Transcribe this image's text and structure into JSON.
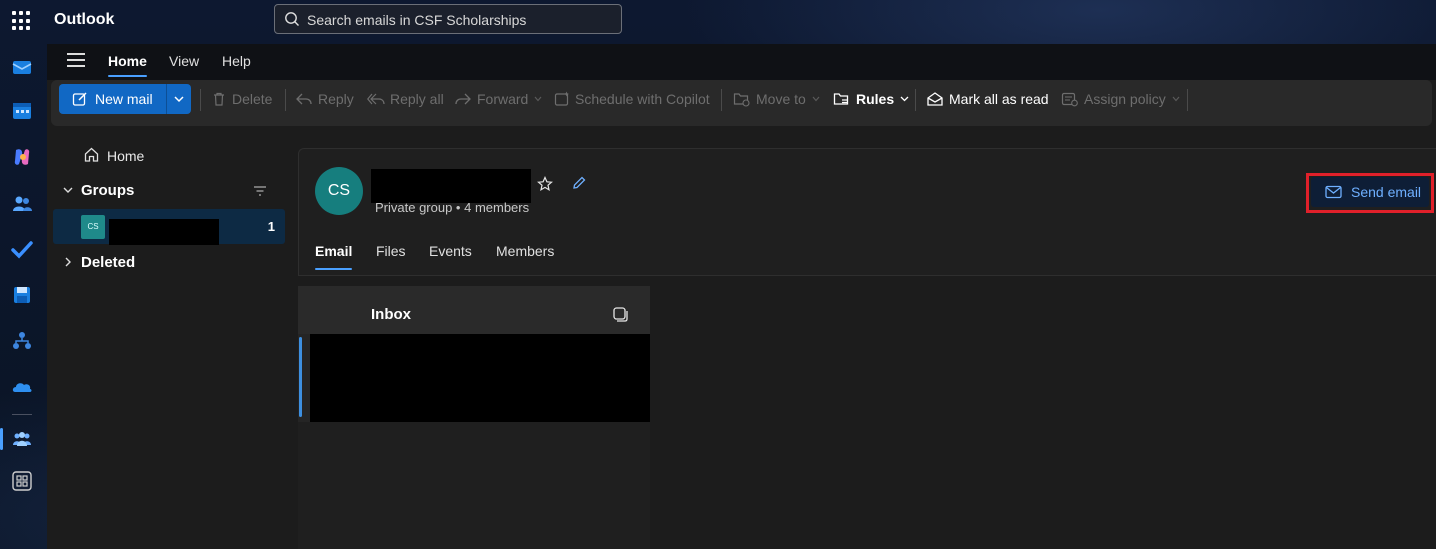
{
  "app": {
    "title": "Outlook"
  },
  "search": {
    "placeholder": "Search emails in CSF Scholarships"
  },
  "menu_tabs": [
    {
      "label": "Home",
      "active": true
    },
    {
      "label": "View",
      "active": false
    },
    {
      "label": "Help",
      "active": false
    }
  ],
  "ribbon": {
    "new_mail": "New mail",
    "delete": "Delete",
    "reply": "Reply",
    "reply_all": "Reply all",
    "forward": "Forward",
    "schedule": "Schedule with Copilot",
    "move_to": "Move to",
    "rules": "Rules",
    "mark_all_read": "Mark all as read",
    "assign_policy": "Assign policy"
  },
  "folders": {
    "home": "Home",
    "groups": "Groups",
    "group_item": {
      "initials": "CS",
      "count": "1"
    },
    "deleted": "Deleted"
  },
  "group": {
    "initials": "CS",
    "subtitle": "Private group • 4 members",
    "send_email": "Send email",
    "tabs": [
      {
        "label": "Email",
        "active": true
      },
      {
        "label": "Files",
        "active": false
      },
      {
        "label": "Events",
        "active": false
      },
      {
        "label": "Members",
        "active": false
      }
    ]
  },
  "message_list": {
    "title": "Inbox"
  },
  "colors": {
    "accent": "#4aa0ff",
    "new_mail_button": "#1168c4",
    "avatar": "#167e7e",
    "highlight": "#e0202a"
  },
  "icons": {
    "rail": [
      "mail-icon",
      "calendar-icon",
      "copilot-icon",
      "people-icon",
      "todo-icon",
      "save-icon",
      "org-icon",
      "onedrive-icon",
      "groups-icon",
      "apps-icon"
    ]
  }
}
